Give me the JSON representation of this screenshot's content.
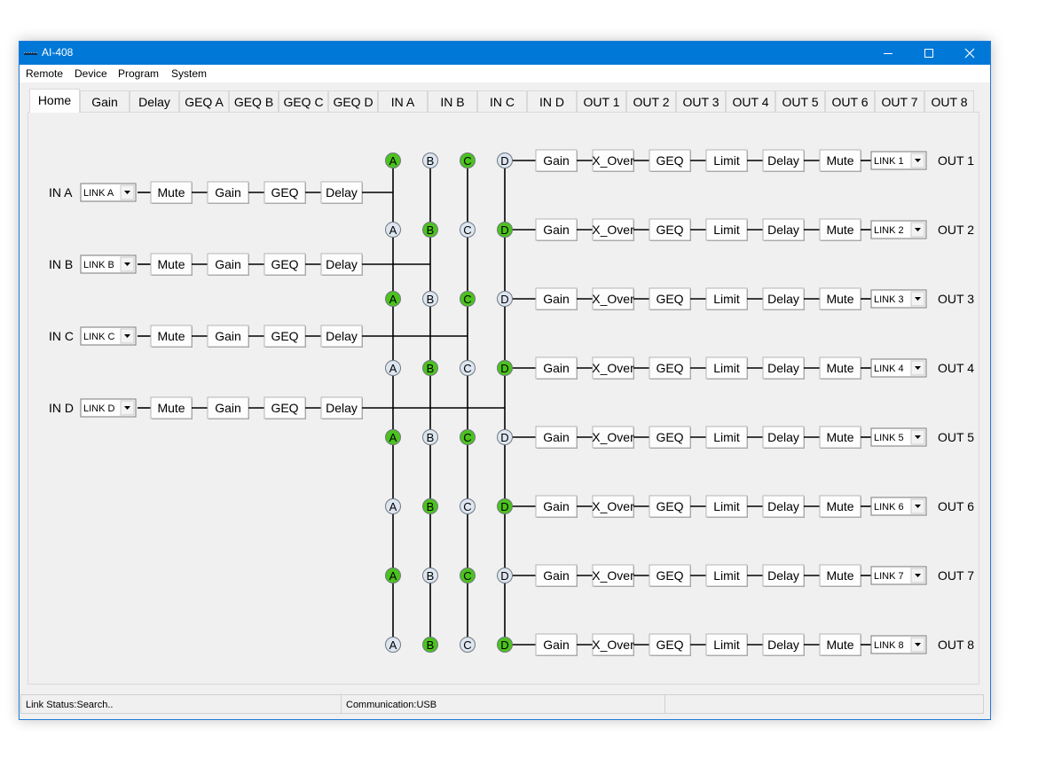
{
  "window": {
    "title": "AI-408"
  },
  "menu": [
    "Remote",
    "Device",
    "Program",
    "System"
  ],
  "tabs": [
    "Home",
    "Gain",
    "Delay",
    "GEQ A",
    "GEQ B",
    "GEQ C",
    "GEQ D",
    "IN A",
    "IN B",
    "IN C",
    "IN D",
    "OUT 1",
    "OUT 2",
    "OUT 3",
    "OUT 4",
    "OUT 5",
    "OUT 6",
    "OUT 7",
    "OUT 8"
  ],
  "active_tab": "Home",
  "inputs": [
    {
      "label": "IN A",
      "link": "LINK A"
    },
    {
      "label": "IN B",
      "link": "LINK B"
    },
    {
      "label": "IN C",
      "link": "LINK C"
    },
    {
      "label": "IN D",
      "link": "LINK D"
    }
  ],
  "input_chain": [
    "Mute",
    "Gain",
    "GEQ",
    "Delay"
  ],
  "output_chain": [
    "Gain",
    "X_Over",
    "GEQ",
    "Limit",
    "Delay",
    "Mute"
  ],
  "matrix_columns": [
    "A",
    "B",
    "C",
    "D"
  ],
  "outputs": [
    {
      "label": "OUT 1",
      "link": "LINK 1",
      "routes": [
        true,
        false,
        true,
        false
      ]
    },
    {
      "label": "OUT 2",
      "link": "LINK 2",
      "routes": [
        false,
        true,
        false,
        true
      ]
    },
    {
      "label": "OUT 3",
      "link": "LINK 3",
      "routes": [
        true,
        false,
        true,
        false
      ]
    },
    {
      "label": "OUT 4",
      "link": "LINK 4",
      "routes": [
        false,
        true,
        false,
        true
      ]
    },
    {
      "label": "OUT 5",
      "link": "LINK 5",
      "routes": [
        true,
        false,
        true,
        false
      ]
    },
    {
      "label": "OUT 6",
      "link": "LINK 6",
      "routes": [
        false,
        true,
        false,
        true
      ]
    },
    {
      "label": "OUT 7",
      "link": "LINK 7",
      "routes": [
        true,
        false,
        true,
        false
      ]
    },
    {
      "label": "OUT 8",
      "link": "LINK 8",
      "routes": [
        false,
        true,
        false,
        true
      ]
    }
  ],
  "status": {
    "link": "Link Status:Search..",
    "communication": "Communication:USB",
    "extra": ""
  },
  "colors": {
    "active_node": "#4cc21f",
    "inactive_node": "#dde6f0",
    "titlebar": "#0078d7"
  }
}
